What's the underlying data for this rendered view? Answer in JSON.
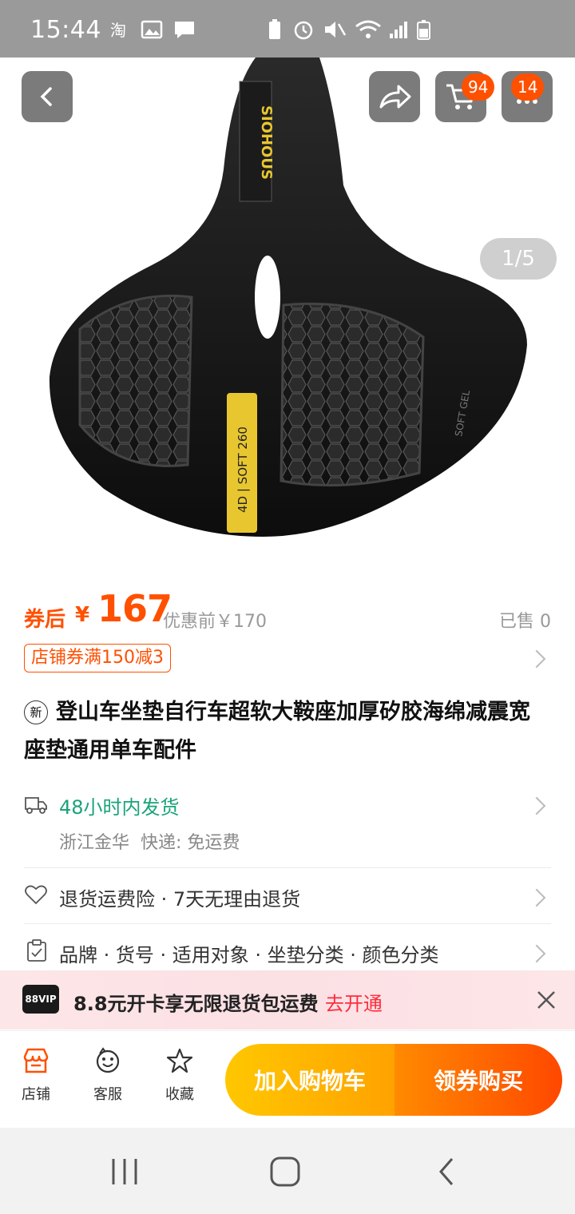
{
  "status_bar": {
    "time": "15:44"
  },
  "header": {
    "cart_count": "94",
    "menu_count": "14",
    "page_indicator": "1/5"
  },
  "product_image": {
    "brand_text": "SIOHOUS",
    "strip_text": "4D | SOFT 260",
    "side_text": "SOFT GEL"
  },
  "price": {
    "prefix": "券后",
    "currency": "¥",
    "amount": "167",
    "original": "优惠前￥170",
    "sold": "已售 0"
  },
  "coupon": {
    "label": "店铺券满150减3"
  },
  "title": {
    "badge": "新",
    "text": "登山车坐垫自行车超软大鞍座加厚矽胶海绵减震宽座垫通用单车配件"
  },
  "shipping": {
    "headline": "48小时内发货",
    "detail": "浙江金华  快递: 免运费"
  },
  "returns": {
    "text": "退货运费险 · 7天无理由退货"
  },
  "specs": {
    "text": "品牌 · 货号 · 适用对象 · 坐垫分类 · 颜色分类"
  },
  "vip_banner": {
    "logo": "88VIP",
    "text": "8.8元开卡享无限退货包运费",
    "action": "去开通"
  },
  "bottom": {
    "shop": "店铺",
    "service": "客服",
    "favorite": "收藏",
    "add_cart": "加入购物车",
    "buy": "领券购买"
  },
  "colors": {
    "accent": "#ff5000",
    "green": "#1aa37a",
    "add_cart_start": "#ffb300",
    "buy_end": "#ff4800"
  }
}
